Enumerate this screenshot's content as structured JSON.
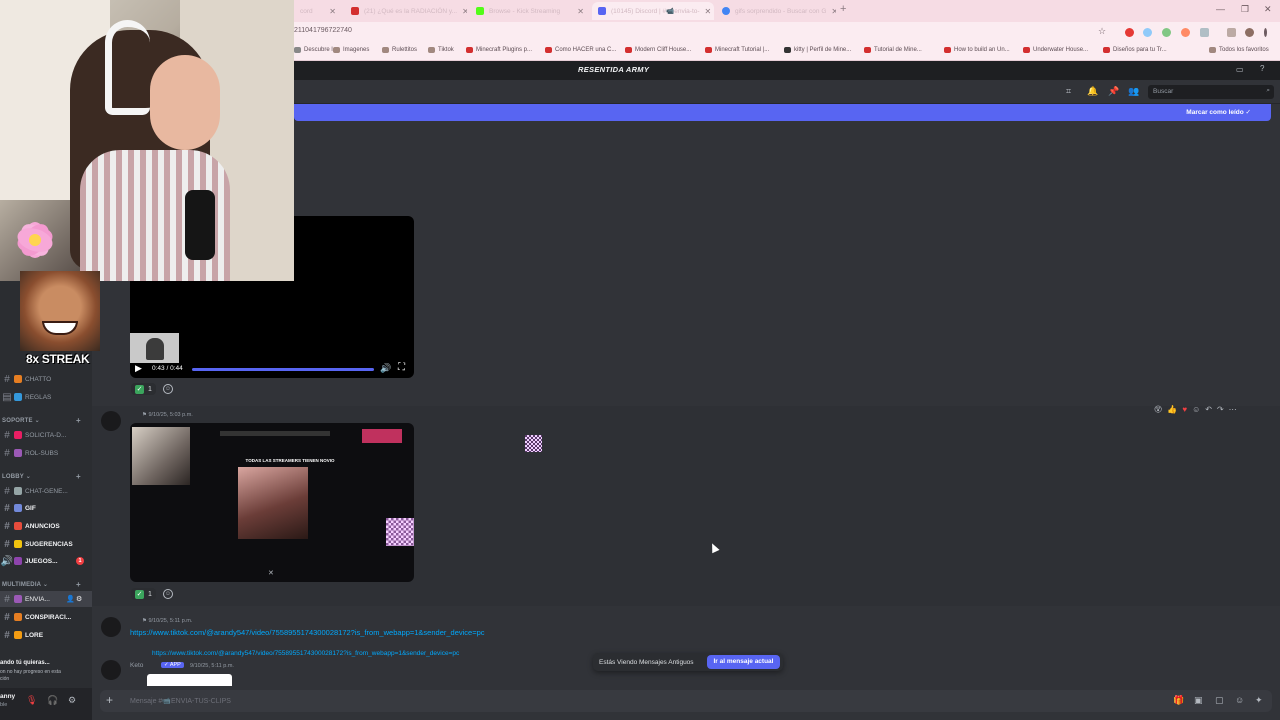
{
  "browser": {
    "tabs": [
      {
        "label": "cord",
        "fav": "#c9a7b3"
      },
      {
        "label": "(21) ¿Qué es la RADIACIÓN y...",
        "fav": "#d32f2f"
      },
      {
        "label": "Browse - Kick Streaming",
        "fav": "#53fc18"
      },
      {
        "label": "(10145) Discord | #📹envia-to-",
        "fav": "#5865f2"
      },
      {
        "label": "gifs sorprendido - Buscar con G",
        "fav": "#4285f4"
      }
    ],
    "url": "211041796722740",
    "bookmarks": [
      {
        "label": "Descubre l...",
        "fav": "#888888"
      },
      {
        "label": "Imagenes",
        "fav": "#a1887f"
      },
      {
        "label": "Rulettitos",
        "fav": "#a1887f"
      },
      {
        "label": "Tiktok",
        "fav": "#a1887f"
      },
      {
        "label": "Minecraft Plugins p...",
        "fav": "#d32f2f"
      },
      {
        "label": "Como HACER una C...",
        "fav": "#d32f2f"
      },
      {
        "label": "Modern Cliff House...",
        "fav": "#d32f2f"
      },
      {
        "label": "Minecraft Tutorial |...",
        "fav": "#d32f2f"
      },
      {
        "label": "kitty | Perfil de Mine...",
        "fav": "#333333"
      },
      {
        "label": "Tutorial de Mine...",
        "fav": "#d32f2f"
      },
      {
        "label": "How to build an Un...",
        "fav": "#d32f2f"
      },
      {
        "label": "Underwater House...",
        "fav": "#d32f2f"
      },
      {
        "label": "Diseños para tu Tr...",
        "fav": "#d32f2f"
      }
    ],
    "all_bookmarks": "Todos los favoritos"
  },
  "discord": {
    "server_name": "RESENTIDA ARMY",
    "search_placeholder": "Buscar",
    "mark_read": "Marcar como leído",
    "sidebar": {
      "channels_top": [
        {
          "label": "CHATTO",
          "color": "#e67e22"
        },
        {
          "label": "REGLAS",
          "color": "#3498db"
        }
      ],
      "cat_soporte": "SOPORTE",
      "soporte": [
        {
          "label": "SOLICITA-D...",
          "color": "#e91e63"
        },
        {
          "label": "ROL-SUBS",
          "color": "#9b59b6"
        }
      ],
      "cat_lobby": "LOBBY",
      "lobby": [
        {
          "label": "CHAT-GENE...",
          "color": "#95a5a6"
        },
        {
          "label": "GIF",
          "color": "#7289da"
        },
        {
          "label": "ANUNCIOS",
          "color": "#e74c3c"
        },
        {
          "label": "SUGERENCIAS",
          "color": "#f1c40f"
        },
        {
          "label": "JUEGOS...",
          "color": "#8e44ad"
        }
      ],
      "juegos_badge": "1",
      "cat_multimedia": "MULTIMEDIA",
      "multimedia": [
        {
          "label": "ENVIA...",
          "color": "#9b59b6"
        },
        {
          "label": "CONSPIRACI...",
          "color": "#e67e22"
        },
        {
          "label": "LORE",
          "color": "#f39c12"
        }
      ]
    },
    "toast": {
      "title": "ando tú quieras...",
      "body": "on no hay progreso en esta ción"
    },
    "user": {
      "name": "anny",
      "status": "ble"
    },
    "messages": {
      "video1_time": "0:43 / 0:44",
      "react1_count": "1",
      "msg2_time": "9/10/25, 5:03 p.m.",
      "video2_heading": "TODAS LAS STREAMERS TIENEN NOVIO",
      "react2_count": "1",
      "msg3_time": "9/10/25, 5:11 p.m.",
      "msg3_link": "https://www.tiktok.com/@arandy547/video/7558955174300028172?is_from_webapp=1&sender_device=pc",
      "reply_link": "https://www.tiktok.com/@arandy547/video/7558955174300028172?is_from_webapp=1&sender_device=pc",
      "msg4_author": "Keto",
      "msg4_app": "✓ APP",
      "msg4_time": "9/10/25, 5:11 p.m."
    },
    "jump": {
      "text": "Estás Viendo Mensajes Antiguos",
      "button": "Ir al mensaje actual"
    },
    "composer_placeholder": "Mensaje #📹ENVIA-TUS-CLIPS"
  },
  "overlay": {
    "streak": "8x STREAK"
  }
}
